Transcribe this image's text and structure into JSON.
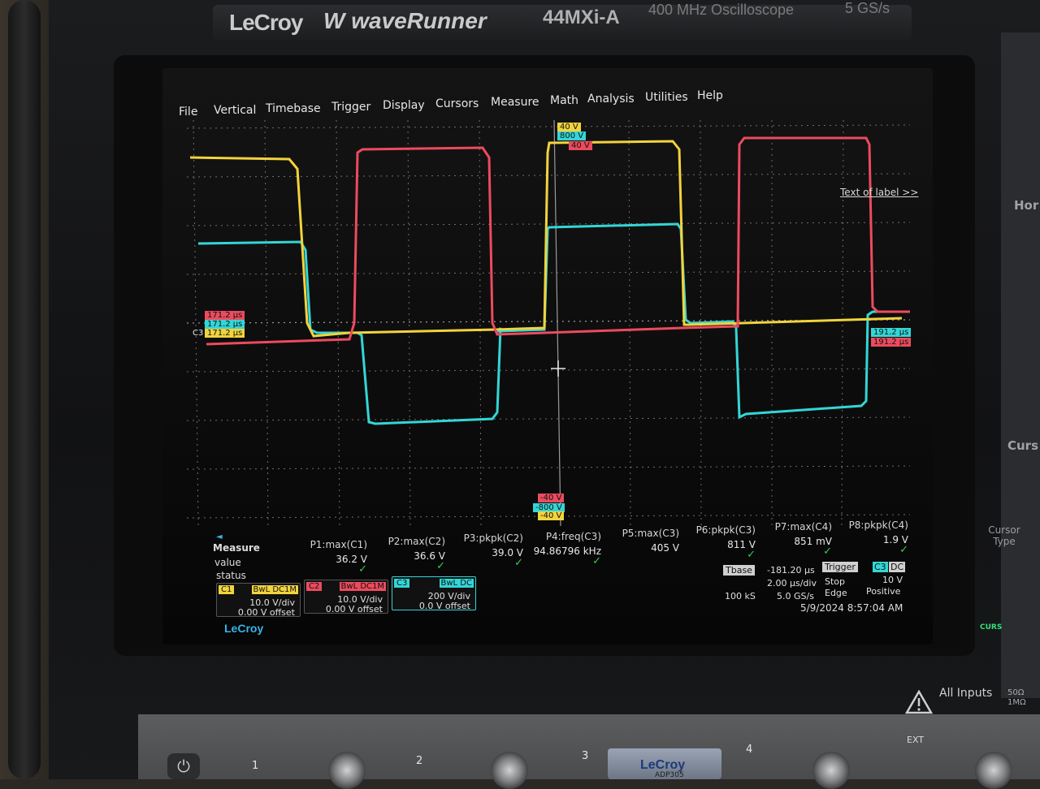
{
  "device": {
    "brand": "LeCroy",
    "series": "waveRunner",
    "series_prefix": "W",
    "model": "44MXi-A",
    "description": "400 MHz Oscilloscope",
    "sample_rate": "5 GS/s"
  },
  "menu": [
    "File",
    "Vertical",
    "Timebase",
    "Trigger",
    "Display",
    "Cursors",
    "Measure",
    "Math",
    "Analysis",
    "Utilities",
    "Help"
  ],
  "text_of_label": "Text of label >>",
  "colors": {
    "c1": "#f2d33c",
    "c2": "#ec4b5e",
    "c3": "#33d6d6",
    "grid": "#6e6e6e"
  },
  "markers": {
    "top_c1": "40 V",
    "top_c3": "800 V",
    "top_c2": "40 V",
    "bottom_c2": "-40 V",
    "bottom_c3": "-800 V",
    "bottom_c1": "-40 V",
    "left_c2": "171.2 µs",
    "left_c3": "171.2 µs",
    "left_c1": "171.2 µs",
    "left_c3_tag": "C3",
    "right_c3": "191.2 µs",
    "right_c2": "191.2 µs"
  },
  "measure": {
    "head": "Measure",
    "value_label": "value",
    "status_label": "status",
    "items": [
      {
        "name": "P1:max(C1)",
        "value": "36.2 V",
        "status": "✓"
      },
      {
        "name": "P2:max(C2)",
        "value": "36.6 V",
        "status": "✓"
      },
      {
        "name": "P3:pkpk(C2)",
        "value": "39.0 V",
        "status": "✓"
      },
      {
        "name": "P4:freq(C3)",
        "value": "94.86796 kHz",
        "status": "✓"
      },
      {
        "name": "P5:max(C3)",
        "value": "405 V",
        "status": ""
      },
      {
        "name": "P6:pkpk(C3)",
        "value": "811 V",
        "status": "✓"
      },
      {
        "name": "P7:max(C4)",
        "value": "851 mV",
        "status": "✓"
      },
      {
        "name": "P8:pkpk(C4)",
        "value": "1.9 V",
        "status": "✓"
      }
    ]
  },
  "channels": [
    {
      "tag": "C1",
      "flags": "BwL DC1M",
      "vdiv": "10.0 V/div",
      "offset": "0.00 V offset",
      "color": "#f2d33c"
    },
    {
      "tag": "C2",
      "flags": "BwL DC1M",
      "vdiv": "10.0 V/div",
      "offset": "0.00 V offset",
      "color": "#ec4b5e"
    },
    {
      "tag": "C3",
      "flags": "BwL DC",
      "vdiv": "200 V/div",
      "offset": "0.0 V offset",
      "color": "#33d6d6"
    }
  ],
  "ui_logo": "LeCroy",
  "timebase": {
    "label": "Tbase",
    "delay": "-181.20 µs",
    "per_div": "2.00 µs/div",
    "samples": "100 kS",
    "rate": "5.0 GS/s"
  },
  "trigger": {
    "label": "Trigger",
    "source": "C3",
    "coupling": "DC",
    "mode": "Stop",
    "level": "10 V",
    "type": "Edge",
    "slope": "Positive"
  },
  "datetime": "5/9/2024 8:57:04 AM",
  "front_panel": {
    "all_inputs": "All Inputs",
    "input_spec": "50Ω\n1MΩ",
    "channel_numbers": [
      "1",
      "2",
      "3",
      "4"
    ],
    "ext": "EXT",
    "probe_brand": "LeCroy",
    "probe_model": "ADP305",
    "side_labels": [
      "Hor",
      "Curs"
    ],
    "cursor_type": "Cursor Type",
    "curs_led": "CURS"
  }
}
